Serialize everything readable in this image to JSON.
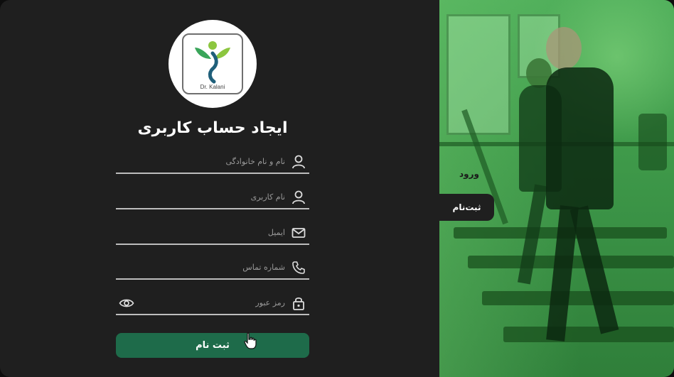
{
  "brand": {
    "logo_text": "Dr. Kalani"
  },
  "form": {
    "title": "ایجاد حساب کاربری",
    "fields": [
      {
        "placeholder": "نام و نام خانوادگی",
        "icon": "user-icon"
      },
      {
        "placeholder": "نام کاربری",
        "icon": "user-icon"
      },
      {
        "placeholder": "ایمیل",
        "icon": "mail-icon"
      },
      {
        "placeholder": "شماره تماس",
        "icon": "phone-icon"
      },
      {
        "placeholder": "رمز عبور",
        "icon": "lock-icon",
        "toggle_icon": "eye-icon"
      }
    ],
    "submit_label": "ثبت نام"
  },
  "tabs": {
    "login_label": "ورود",
    "register_label": "ثبت‌نام"
  },
  "colors": {
    "panel_bg": "#1f1f1f",
    "accent_green": "#1e6b4a",
    "hero_green": "#3f9a4a"
  }
}
